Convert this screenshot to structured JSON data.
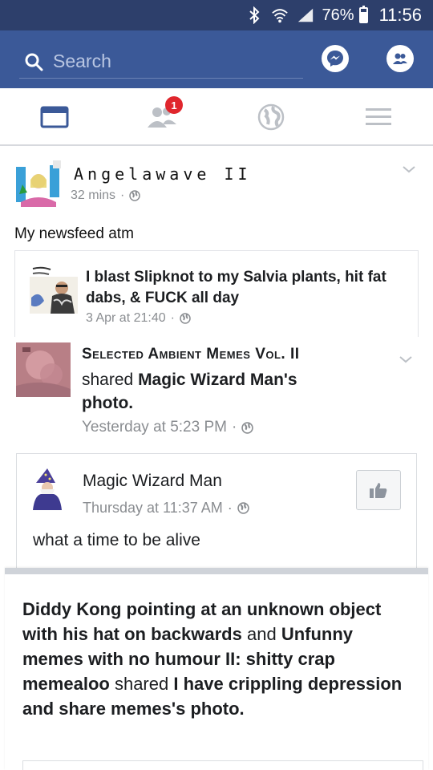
{
  "status_bar": {
    "battery": "76%",
    "battery_level": 0.76,
    "time": "11:56"
  },
  "header": {
    "search_placeholder": "Search"
  },
  "tabbar": {
    "friend_requests_badge": "1"
  },
  "post": {
    "author": "Angelawave II",
    "time": "32 mins",
    "text": "My newsfeed atm",
    "quote": {
      "text": "I blast Slipknot to my Salvia plants, hit fat dabs, & FUCK all day",
      "time": "3 Apr at 21:40"
    },
    "shared": {
      "page_name": "Selected Ambient Memes Vol. II",
      "action": "shared",
      "owner": "Magic Wizard Man's",
      "object": "photo.",
      "time": "Yesterday at 5:23 PM",
      "inner": {
        "author": "Magic Wizard Man",
        "time": "Thursday at 11:37 AM",
        "text": "what a time to be alive"
      }
    },
    "deep": {
      "page1": "Diddy Kong pointing at an unknown object with his hat on backwards",
      "and": "and",
      "page2": "Unfunny memes with no humour II: shitty crap memealoo",
      "action": "shared",
      "owner": "I have crippling depression and share memes's",
      "object": "photo."
    }
  }
}
